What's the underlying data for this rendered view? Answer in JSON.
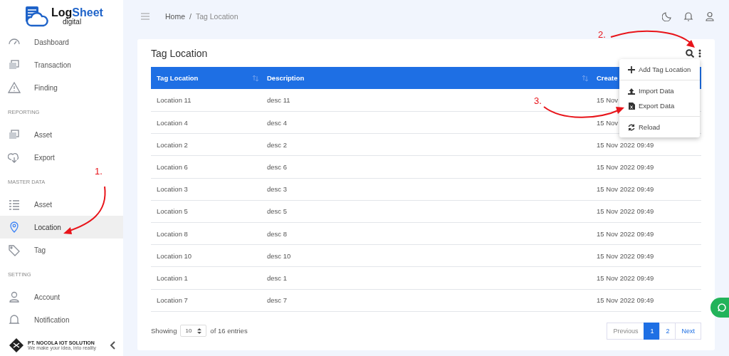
{
  "brand": {
    "name_start": "Log",
    "name_end": "Sheet",
    "sub": "digital"
  },
  "sidebar": {
    "sections": [
      {
        "items": [
          {
            "label": "Dashboard",
            "selected": false
          },
          {
            "label": "Transaction",
            "selected": false
          },
          {
            "label": "Finding",
            "selected": false
          }
        ]
      },
      {
        "heading": "REPORTING",
        "items": [
          {
            "label": "Asset",
            "selected": false
          },
          {
            "label": "Export",
            "selected": false
          }
        ]
      },
      {
        "heading": "MASTER DATA",
        "items": [
          {
            "label": "Asset",
            "selected": false
          },
          {
            "label": "Location",
            "selected": true
          },
          {
            "label": "Tag",
            "selected": false
          }
        ]
      },
      {
        "heading": "SETTING",
        "items": [
          {
            "label": "Account",
            "selected": false
          },
          {
            "label": "Notification",
            "selected": false
          }
        ]
      }
    ],
    "footer": {
      "company": "PT. NOCOLA IOT SOLUTION",
      "tagline": "We make your idea, into reality"
    }
  },
  "breadcrumb": {
    "items": [
      "Home",
      "Tag Location"
    ],
    "separator": "/"
  },
  "card": {
    "title": "Tag Location",
    "columns": [
      "Tag Location",
      "Description",
      "Create"
    ],
    "rows": [
      [
        "Location 11",
        "desc 11",
        "15 Nov"
      ],
      [
        "Location 4",
        "desc 4",
        "15 Nov"
      ],
      [
        "Location 2",
        "desc 2",
        "15 Nov 2022 09:49"
      ],
      [
        "Location 6",
        "desc 6",
        "15 Nov 2022 09:49"
      ],
      [
        "Location 3",
        "desc 3",
        "15 Nov 2022 09:49"
      ],
      [
        "Location 5",
        "desc 5",
        "15 Nov 2022 09:49"
      ],
      [
        "Location 8",
        "desc 8",
        "15 Nov 2022 09:49"
      ],
      [
        "Location 10",
        "desc 10",
        "15 Nov 2022 09:49"
      ],
      [
        "Location 1",
        "desc 1",
        "15 Nov 2022 09:49"
      ],
      [
        "Location 7",
        "desc 7",
        "15 Nov 2022 09:49"
      ]
    ],
    "menu": [
      [
        "Add Tag Location"
      ],
      [
        "Import Data",
        "Export Data"
      ],
      [
        "Reload"
      ]
    ],
    "showing": {
      "before": "Showing",
      "page_size": "10",
      "after": "of 16 entries"
    },
    "pagination": [
      {
        "label": "Previous",
        "selected": false,
        "disabled": true
      },
      {
        "label": "1",
        "selected": true,
        "disabled": false
      },
      {
        "label": "2",
        "selected": false,
        "disabled": false
      },
      {
        "label": "Next",
        "selected": false,
        "disabled": false
      }
    ]
  },
  "annotations": [
    "1.",
    "2.",
    "3."
  ]
}
